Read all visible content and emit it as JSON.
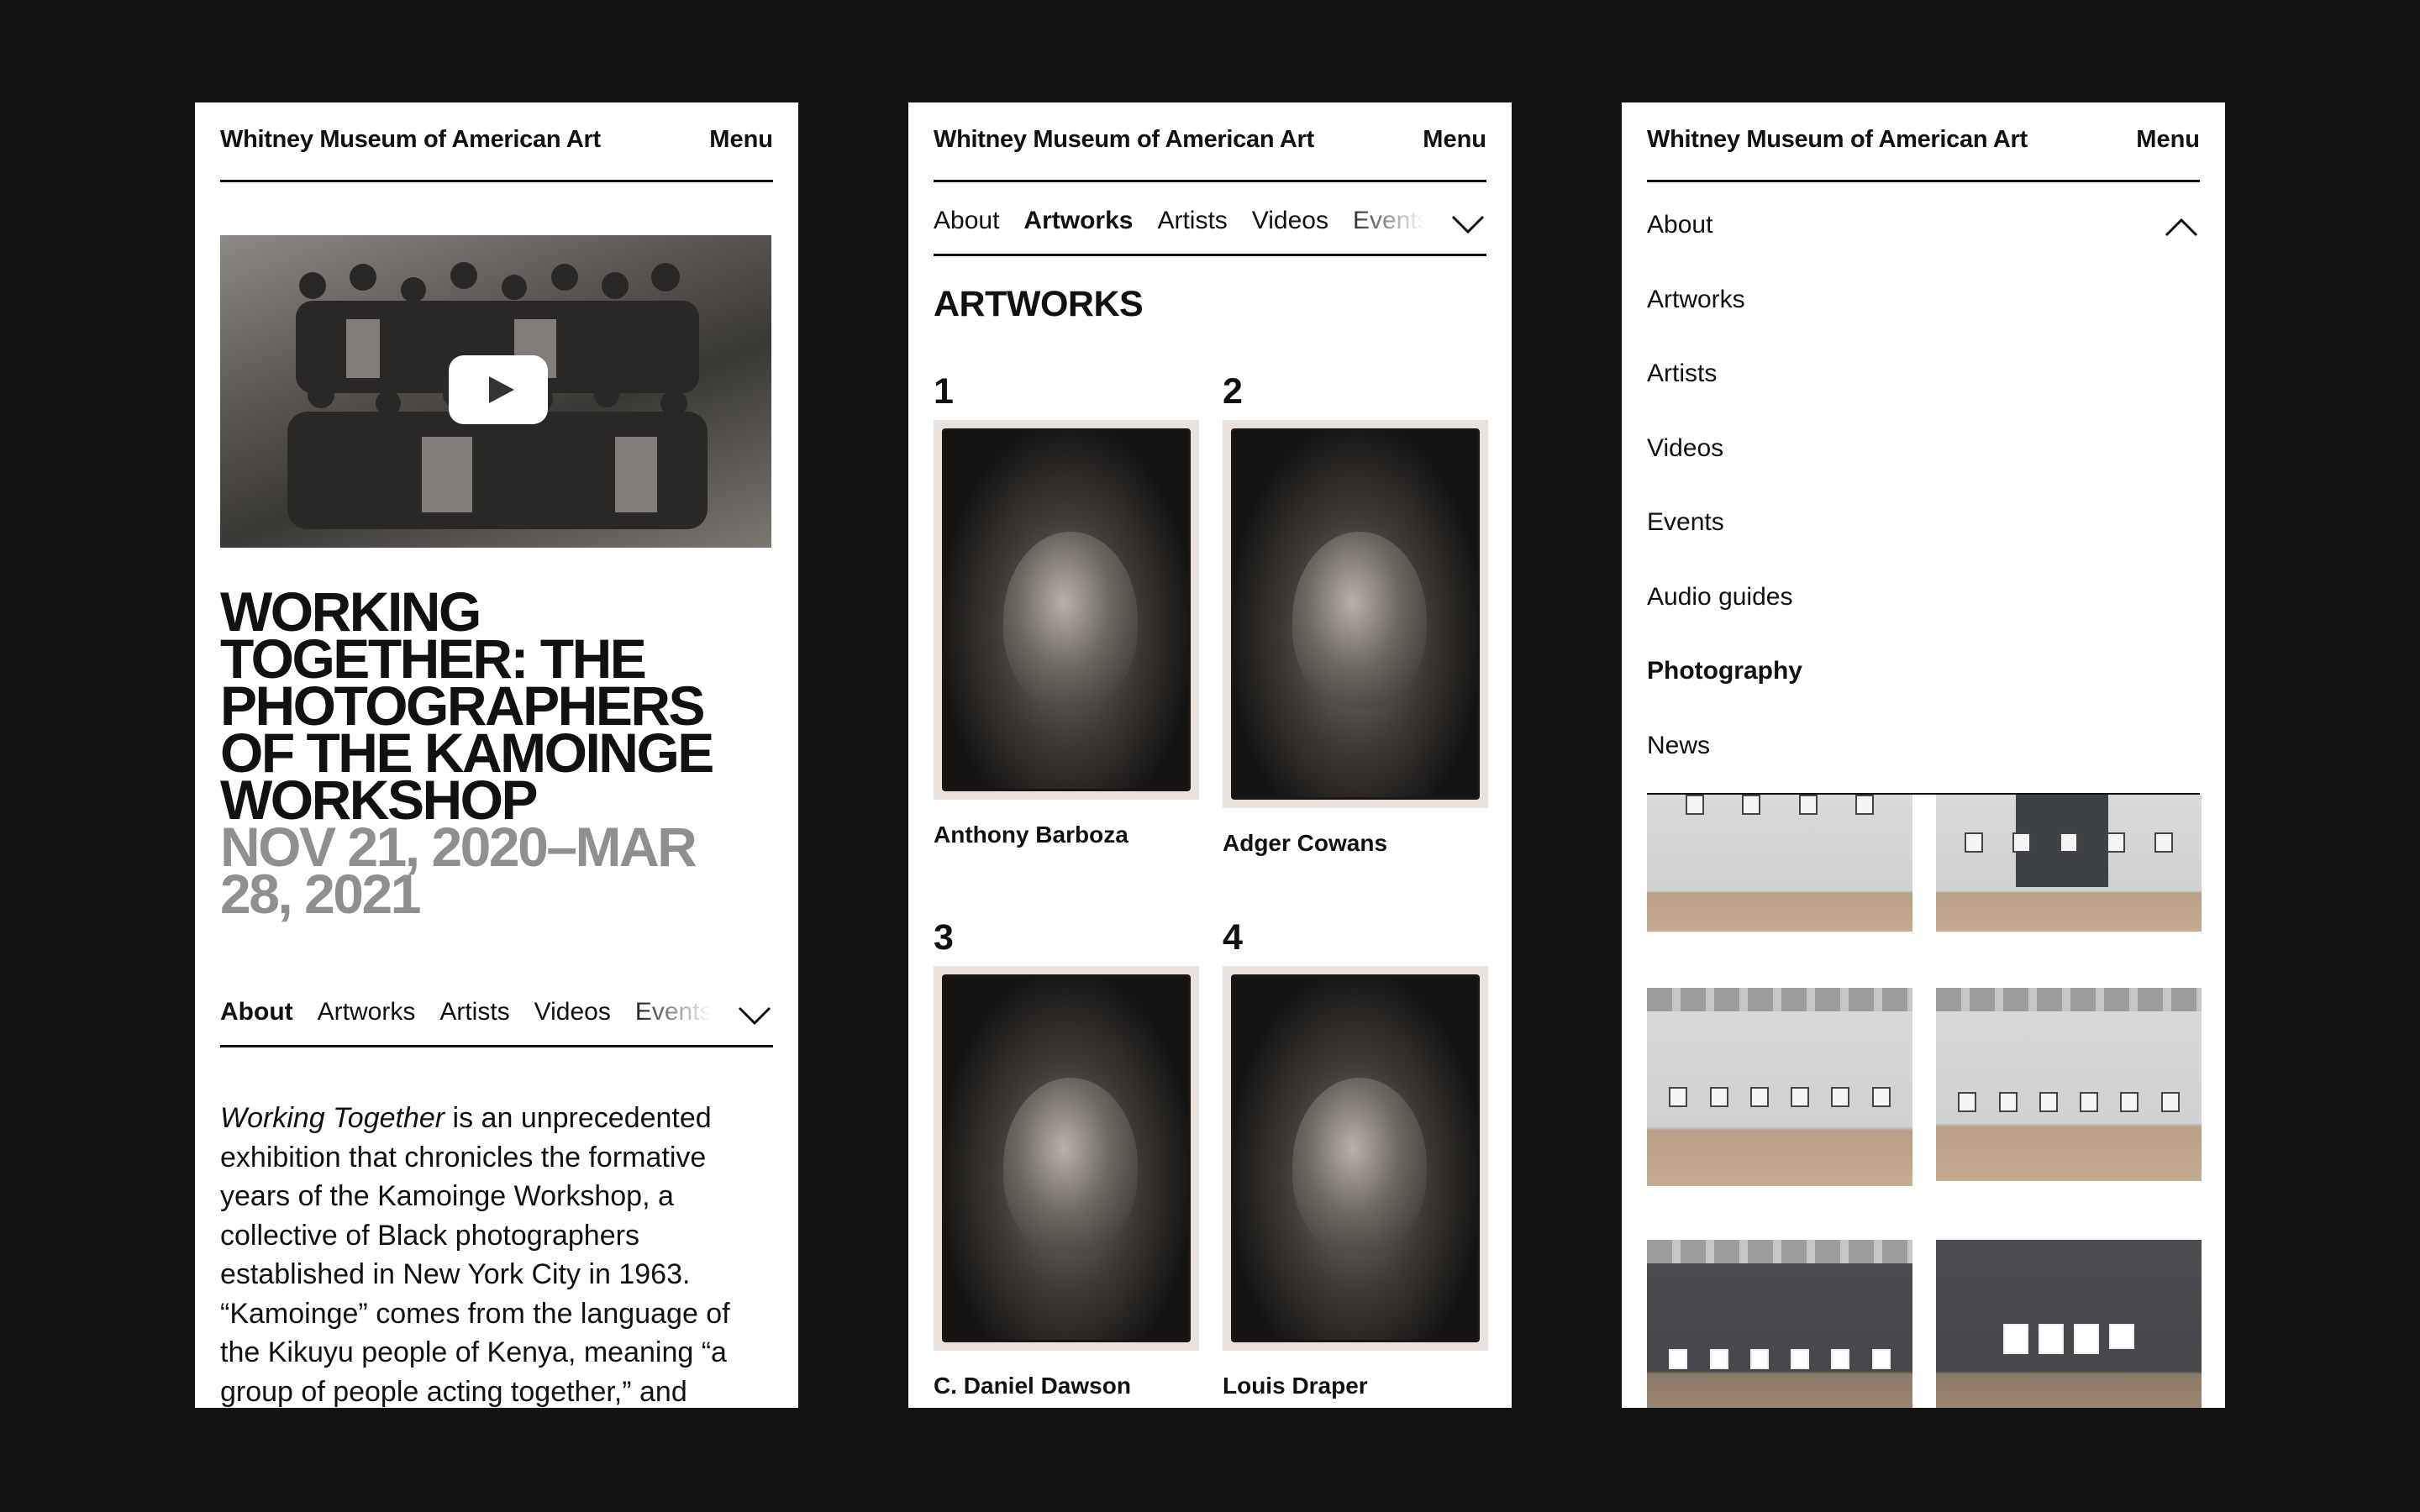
{
  "brand": "Whitney Museum of American Art",
  "menu_label": "Menu",
  "tabs": [
    "About",
    "Artworks",
    "Artists",
    "Videos",
    "Events"
  ],
  "screen1": {
    "title": "Working Together: The Photographers of the Kamoinge Workshop",
    "dates": "Nov 21, 2020–Mar 28, 2021",
    "active_tab": "About",
    "body_italic": "Working Together",
    "body_rest": " is an unprecedented exhibition that chronicles the formative years of the Kamoinge Workshop, a collective of Black photographers established in New York City in 1963. “Kamoinge” comes from the language of the Kikuyu people of Kenya, meaning “a group of people acting together,” and"
  },
  "screen2": {
    "active_tab": "Artworks",
    "heading": "ARTWORKS",
    "artworks": [
      {
        "number": "1",
        "artist": "Anthony Barboza"
      },
      {
        "number": "2",
        "artist": "Adger Cowans"
      },
      {
        "number": "3",
        "artist": "C. Daniel Dawson"
      },
      {
        "number": "4",
        "artist": "Louis Draper"
      }
    ]
  },
  "screen3": {
    "nav": [
      "About",
      "Artworks",
      "Artists",
      "Videos",
      "Events",
      "Audio guides",
      "Photography",
      "News"
    ],
    "active_item": "Photography"
  },
  "icons": {
    "chevron_down": "chevron-down-icon",
    "chevron_up": "chevron-up-icon",
    "play": "play-icon"
  },
  "colors": {
    "background": "#121212",
    "page": "#ffffff",
    "text": "#111111",
    "date_gray": "#8f8f8f"
  }
}
